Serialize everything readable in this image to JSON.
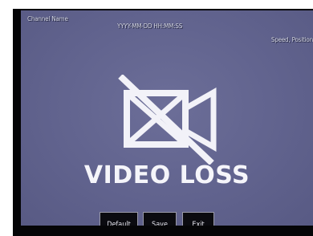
{
  "osd": {
    "channel_name": "Channel Name",
    "datetime": "YYYY-MM-DD HH:MM:SS",
    "speed_position": "Speed, Position"
  },
  "status": {
    "message": "VIDEO LOSS",
    "icon": "video-camera-crossed-out-icon"
  },
  "buttons": {
    "default": "Default",
    "save": "Save",
    "exit": "Exit"
  },
  "colors": {
    "screen_bg": "#64668f",
    "bezel": "#050507",
    "text": "#f5f5fa",
    "button_bg": "#0b0b10"
  }
}
